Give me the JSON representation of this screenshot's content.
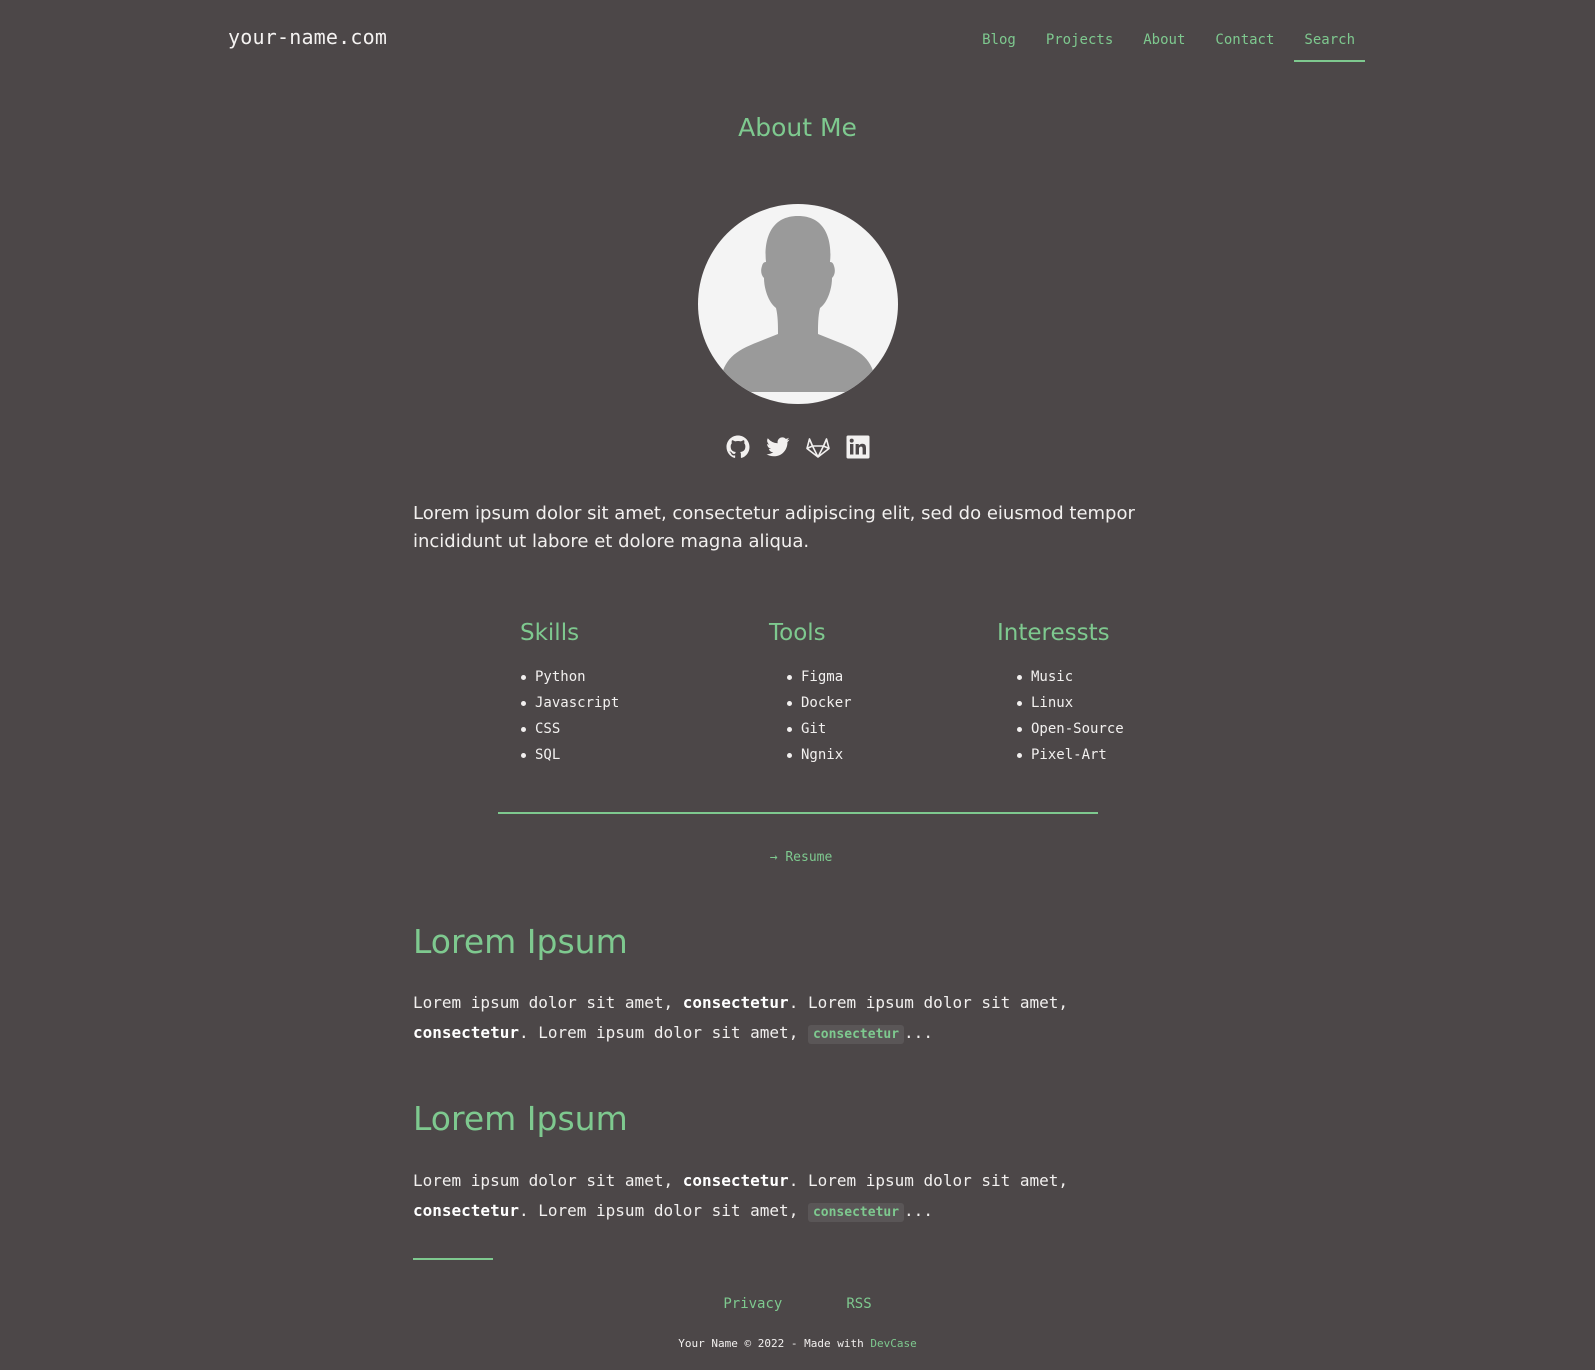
{
  "colors": {
    "background": "#4c4748",
    "accent": "#7ec98f",
    "text": "#f2f0ef"
  },
  "header": {
    "logo": "your-name.com",
    "nav": [
      {
        "label": "Blog"
      },
      {
        "label": "Projects"
      },
      {
        "label": "About"
      },
      {
        "label": "Contact"
      },
      {
        "label": "Search",
        "active": true
      }
    ]
  },
  "main": {
    "title": "About Me",
    "socials": [
      "github-icon",
      "twitter-icon",
      "gitlab-icon",
      "linkedin-icon"
    ],
    "intro": "Lorem ipsum dolor sit amet, consectetur adipiscing elit, sed do eiusmod tempor incididunt ut labore et dolore magna aliqua.",
    "columns": [
      {
        "title": "Skills",
        "items": [
          "Python",
          "Javascript",
          "CSS",
          "SQL"
        ]
      },
      {
        "title": "Tools",
        "items": [
          "Figma",
          "Docker",
          "Git",
          "Ngnix"
        ]
      },
      {
        "title": "Interessts",
        "items": [
          "Music",
          "Linux",
          "Open-Source",
          "Pixel-Art"
        ]
      }
    ],
    "resume": {
      "arrow": "→",
      "label": "Resume"
    },
    "sections": [
      {
        "title": "Lorem Ipsum",
        "text_1": "Lorem ipsum dolor sit amet, ",
        "bold_1": "consectetur",
        "text_2": ". Lorem ipsum dolor sit amet, ",
        "bold_2": "consectetur",
        "text_3": ". Lorem ipsum dolor sit amet, ",
        "code": "consectetur",
        "text_4": "..."
      },
      {
        "title": "Lorem Ipsum",
        "text_1": "Lorem ipsum dolor sit amet, ",
        "bold_1": "consectetur",
        "text_2": ". Lorem ipsum dolor sit amet, ",
        "bold_2": "consectetur",
        "text_3": ". Lorem ipsum dolor sit amet, ",
        "code": "consectetur",
        "text_4": "..."
      }
    ]
  },
  "footer": {
    "links": [
      {
        "label": "Privacy"
      },
      {
        "label": "RSS"
      }
    ],
    "copyright_text": "Your Name © 2022 - Made with ",
    "made_with_link": "DevCase"
  }
}
